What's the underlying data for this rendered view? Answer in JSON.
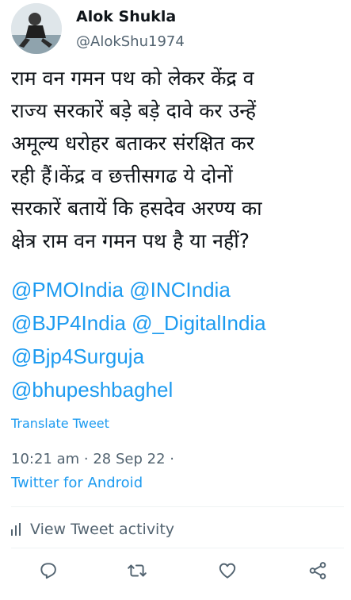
{
  "author": {
    "name": "Alok Shukla",
    "handle": "@AlokShu1974"
  },
  "tweet": {
    "lines": [
      "राम वन गमन पथ को लेकर केंद्र व",
      "राज्य सरकारें बड़े बड़े दावे कर उन्हें",
      "अमूल्य धरोहर बताकर संरक्षित कर",
      "रही हैं।केंद्र व छत्तीसगढ ये दोनों",
      "सरकारें बतायें कि हसदेव अरण्य का",
      "क्षेत्र राम वन गमन पथ है या नहीं?"
    ],
    "mentions": [
      "@PMOIndia",
      "@INCIndia",
      "@BJP4India",
      "@_DigitalIndia",
      "@Bjp4Surguja",
      "@bhupeshbaghel"
    ]
  },
  "translate_label": "Translate Tweet",
  "meta": {
    "time": "10:21 am",
    "date": "28 Sep 22",
    "source": "Twitter for Android"
  },
  "activity_label": "View Tweet activity",
  "icons": {
    "activity": "bar-chart-icon",
    "reply": "reply-icon",
    "retweet": "retweet-icon",
    "like": "heart-icon",
    "share": "share-icon"
  },
  "colors": {
    "link": "#1d9bf0",
    "secondary": "#536471",
    "text": "#0f1419"
  }
}
